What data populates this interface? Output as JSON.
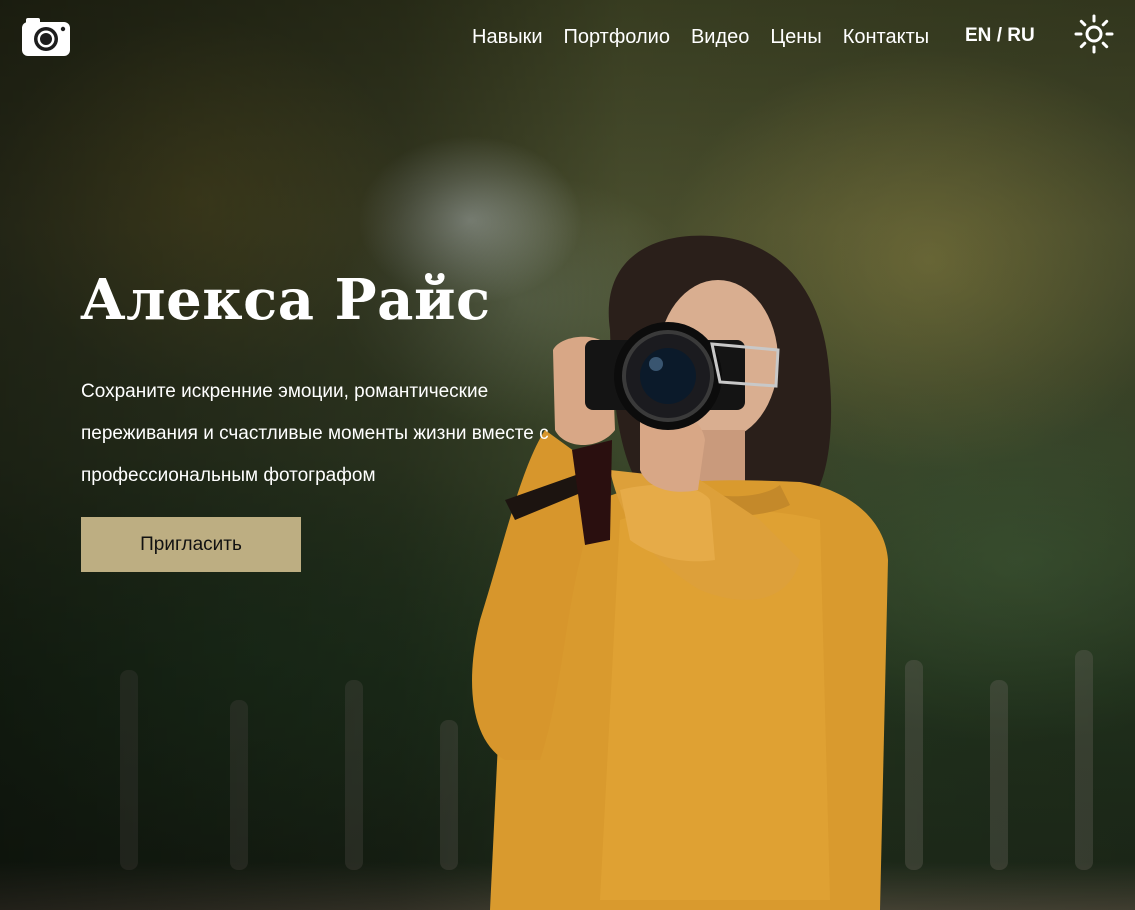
{
  "header": {
    "logo_icon": "camera-icon",
    "nav": [
      {
        "label": "Навыки"
      },
      {
        "label": "Портфолио"
      },
      {
        "label": "Видео"
      },
      {
        "label": "Цены"
      },
      {
        "label": "Контакты"
      }
    ],
    "lang": {
      "en": "EN",
      "separator": "/",
      "ru": "RU"
    },
    "theme_icon": "sun-icon"
  },
  "hero": {
    "title": "Алекса Райс",
    "description": "Сохраните искренние эмоции, романтические переживания и счастливые моменты жизни вместе с профессиональным фотографом",
    "cta_label": "Пригласить",
    "background": "photo of a woman in a yellow sweater holding a camera among trees",
    "colors": {
      "accent": "#bdae82",
      "text": "#ffffff"
    }
  }
}
